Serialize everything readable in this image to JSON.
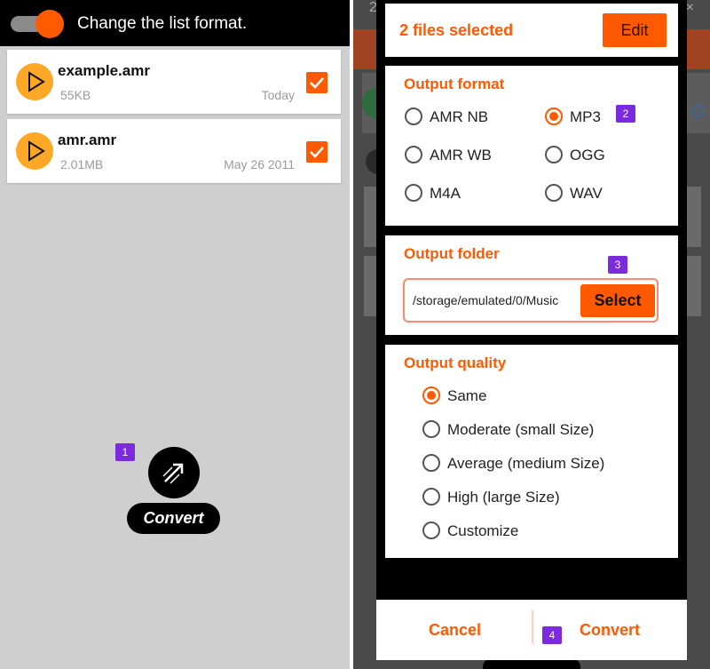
{
  "left_screen": {
    "header_title": "Change the list format.",
    "toggle_state": "on",
    "files": [
      {
        "name": "example.amr",
        "size": "55KB",
        "date": "Today",
        "checked": true
      },
      {
        "name": "amr.amr",
        "size": "2.01MB",
        "date": "May 26 2011",
        "checked": true
      }
    ],
    "convert_label": "Convert",
    "annotation_badge": "1"
  },
  "right_screen": {
    "background_number": "2",
    "background_close": "×",
    "selection_header": {
      "count_text": "2 files selected",
      "edit_label": "Edit"
    },
    "output_format": {
      "title": "Output format",
      "options": [
        {
          "label": "AMR NB",
          "selected": false
        },
        {
          "label": "MP3",
          "selected": true
        },
        {
          "label": "AMR WB",
          "selected": false
        },
        {
          "label": "OGG",
          "selected": false
        },
        {
          "label": "M4A",
          "selected": false
        },
        {
          "label": "WAV",
          "selected": false
        }
      ],
      "annotation_badge": "2"
    },
    "output_folder": {
      "title": "Output folder",
      "path": "/storage/emulated/0/Music",
      "select_label": "Select",
      "annotation_badge": "3"
    },
    "output_quality": {
      "title": "Output quality",
      "options": [
        {
          "label": "Same",
          "selected": true
        },
        {
          "label": "Moderate (small Size)",
          "selected": false
        },
        {
          "label": "Average (medium Size)",
          "selected": false
        },
        {
          "label": "High (large Size)",
          "selected": false
        },
        {
          "label": "Customize",
          "selected": false
        }
      ]
    },
    "footer": {
      "cancel_label": "Cancel",
      "convert_label": "Convert",
      "annotation_badge": "4"
    }
  },
  "colors": {
    "accent": "#ff5a00",
    "badge": "#7b2bdb",
    "play_icon_bg": "#ffa726"
  }
}
